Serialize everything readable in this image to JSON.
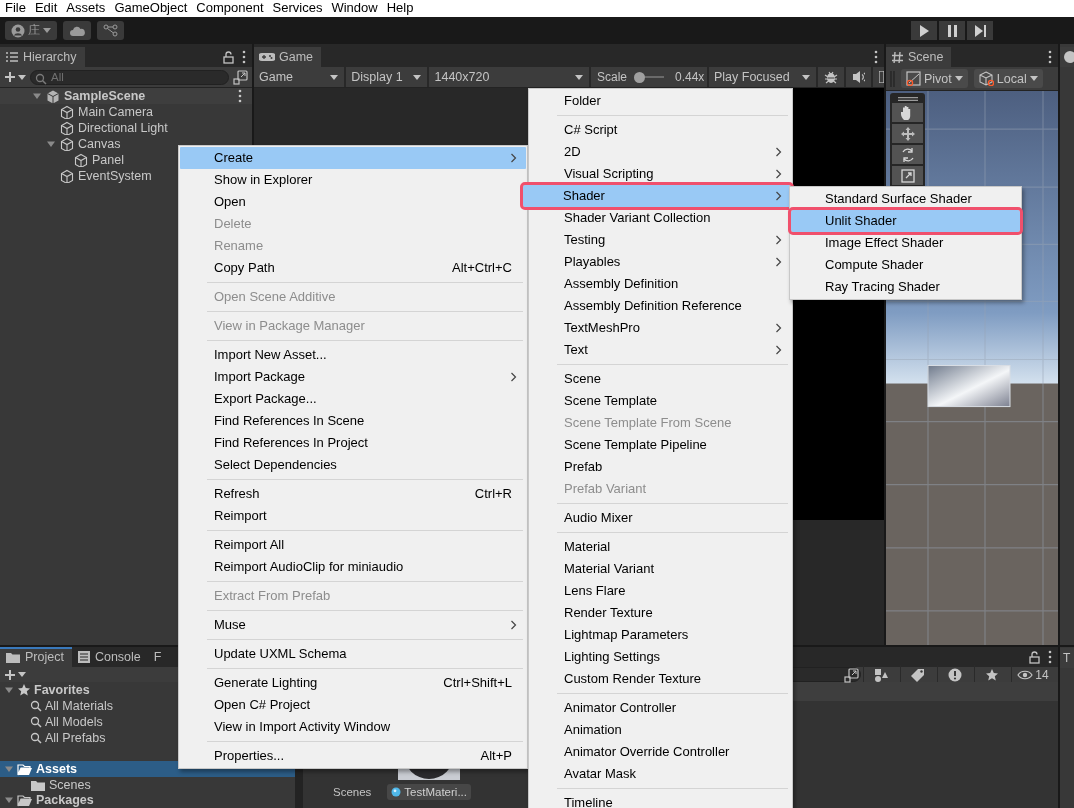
{
  "menu_bar": [
    "File",
    "Edit",
    "Assets",
    "GameObject",
    "Component",
    "Services",
    "Window",
    "Help"
  ],
  "toolbar": {
    "account": "庄"
  },
  "hierarchy": {
    "title": "Hierarchy",
    "search": {
      "placeholder": "All"
    },
    "tree": [
      {
        "label": "SampleScene",
        "kind": "scene",
        "expanded": true,
        "selected": false,
        "children": [
          {
            "label": "Main Camera",
            "kind": "object",
            "selected": false
          },
          {
            "label": "Directional Light",
            "kind": "object",
            "selected": false
          },
          {
            "label": "Canvas",
            "kind": "object",
            "expanded": true,
            "selected": false,
            "children": [
              {
                "label": "Panel",
                "kind": "object",
                "selected": false
              }
            ]
          },
          {
            "label": "EventSystem",
            "kind": "object",
            "selected": false
          }
        ]
      }
    ]
  },
  "game": {
    "title": "Game",
    "view": "Game",
    "display": "Display 1",
    "resolution": "1440x720",
    "scale_label": "Scale",
    "scale": {
      "level": 0.05
    },
    "scale_value": "0.44x",
    "play_mode": "Play Focused"
  },
  "scene": {
    "title": "Scene",
    "pivot": "Pivot",
    "handle": "Local"
  },
  "project": {
    "tabs": [
      {
        "label": "Project",
        "selected": true
      },
      {
        "label": "Console",
        "selected": false
      },
      {
        "label": "F",
        "selected": false
      }
    ],
    "tree": [
      {
        "label": "Favorites",
        "kind": "favorites",
        "expanded": true,
        "selected": false,
        "children": [
          {
            "label": "All Materials",
            "kind": "search",
            "selected": false
          },
          {
            "label": "All Models",
            "kind": "search",
            "selected": false
          },
          {
            "label": "All Prefabs",
            "kind": "search",
            "selected": false
          }
        ]
      },
      {
        "label": "Assets",
        "kind": "folder",
        "expanded": true,
        "selected": true,
        "children": [
          {
            "label": "Scenes",
            "kind": "folder",
            "selected": false
          }
        ]
      },
      {
        "label": "Packages",
        "kind": "folder",
        "expanded": true,
        "selected": false
      }
    ],
    "items": [
      {
        "label": "Scenes",
        "kind": "folder"
      },
      {
        "label": "TestMateri...",
        "kind": "material"
      }
    ],
    "visible_count": "14"
  },
  "inspector": {
    "tab": "T"
  },
  "context_menu": {
    "items": [
      {
        "kind": "item",
        "label": "Create",
        "submenu": true,
        "selected": true,
        "disabled": false
      },
      {
        "kind": "item",
        "label": "Show in Explorer",
        "submenu": false,
        "selected": false,
        "disabled": false
      },
      {
        "kind": "item",
        "label": "Open",
        "submenu": false,
        "selected": false,
        "disabled": false
      },
      {
        "kind": "item",
        "label": "Delete",
        "submenu": false,
        "selected": false,
        "disabled": true
      },
      {
        "kind": "item",
        "label": "Rename",
        "submenu": false,
        "selected": false,
        "disabled": true
      },
      {
        "kind": "item",
        "label": "Copy Path",
        "shortcut": "Alt+Ctrl+C",
        "submenu": false,
        "selected": false,
        "disabled": false
      },
      {
        "kind": "separator"
      },
      {
        "kind": "item",
        "label": "Open Scene Additive",
        "submenu": false,
        "selected": false,
        "disabled": true
      },
      {
        "kind": "separator"
      },
      {
        "kind": "item",
        "label": "View in Package Manager",
        "submenu": false,
        "selected": false,
        "disabled": true
      },
      {
        "kind": "separator"
      },
      {
        "kind": "item",
        "label": "Import New Asset...",
        "submenu": false,
        "selected": false,
        "disabled": false
      },
      {
        "kind": "item",
        "label": "Import Package",
        "submenu": true,
        "selected": false,
        "disabled": false
      },
      {
        "kind": "item",
        "label": "Export Package...",
        "submenu": false,
        "selected": false,
        "disabled": false
      },
      {
        "kind": "item",
        "label": "Find References In Scene",
        "submenu": false,
        "selected": false,
        "disabled": false
      },
      {
        "kind": "item",
        "label": "Find References In Project",
        "submenu": false,
        "selected": false,
        "disabled": false
      },
      {
        "kind": "item",
        "label": "Select Dependencies",
        "submenu": false,
        "selected": false,
        "disabled": false
      },
      {
        "kind": "separator"
      },
      {
        "kind": "item",
        "label": "Refresh",
        "shortcut": "Ctrl+R",
        "submenu": false,
        "selected": false,
        "disabled": false
      },
      {
        "kind": "item",
        "label": "Reimport",
        "submenu": false,
        "selected": false,
        "disabled": false
      },
      {
        "kind": "separator"
      },
      {
        "kind": "item",
        "label": "Reimport All",
        "submenu": false,
        "selected": false,
        "disabled": false
      },
      {
        "kind": "item",
        "label": "Reimport AudioClip for miniaudio",
        "submenu": false,
        "selected": false,
        "disabled": false
      },
      {
        "kind": "separator"
      },
      {
        "kind": "item",
        "label": "Extract From Prefab",
        "submenu": false,
        "selected": false,
        "disabled": true
      },
      {
        "kind": "separator"
      },
      {
        "kind": "item",
        "label": "Muse",
        "submenu": true,
        "selected": false,
        "disabled": false
      },
      {
        "kind": "separator"
      },
      {
        "kind": "item",
        "label": "Update UXML Schema",
        "submenu": false,
        "selected": false,
        "disabled": false
      },
      {
        "kind": "separator"
      },
      {
        "kind": "item",
        "label": "Generate Lighting",
        "shortcut": "Ctrl+Shift+L",
        "submenu": false,
        "selected": false,
        "disabled": false
      },
      {
        "kind": "item",
        "label": "Open C# Project",
        "submenu": false,
        "selected": false,
        "disabled": false
      },
      {
        "kind": "item",
        "label": "View in Import Activity Window",
        "submenu": false,
        "selected": false,
        "disabled": false
      },
      {
        "kind": "separator"
      },
      {
        "kind": "item",
        "label": "Properties...",
        "shortcut": "Alt+P",
        "submenu": false,
        "selected": false,
        "disabled": false
      }
    ]
  },
  "create_menu": {
    "items": [
      {
        "kind": "item",
        "label": "Folder",
        "submenu": false,
        "selected": false,
        "disabled": false
      },
      {
        "kind": "separator"
      },
      {
        "kind": "item",
        "label": "C# Script",
        "submenu": false,
        "selected": false,
        "disabled": false
      },
      {
        "kind": "item",
        "label": "2D",
        "submenu": true,
        "selected": false,
        "disabled": false
      },
      {
        "kind": "item",
        "label": "Visual Scripting",
        "submenu": true,
        "selected": false,
        "disabled": false
      },
      {
        "kind": "item",
        "label": "Shader",
        "submenu": true,
        "selected": true,
        "disabled": false,
        "annotated": true
      },
      {
        "kind": "item",
        "label": "Shader Variant Collection",
        "submenu": false,
        "selected": false,
        "disabled": false
      },
      {
        "kind": "item",
        "label": "Testing",
        "submenu": true,
        "selected": false,
        "disabled": false
      },
      {
        "kind": "item",
        "label": "Playables",
        "submenu": true,
        "selected": false,
        "disabled": false
      },
      {
        "kind": "item",
        "label": "Assembly Definition",
        "submenu": false,
        "selected": false,
        "disabled": false
      },
      {
        "kind": "item",
        "label": "Assembly Definition Reference",
        "submenu": false,
        "selected": false,
        "disabled": false
      },
      {
        "kind": "item",
        "label": "TextMeshPro",
        "submenu": true,
        "selected": false,
        "disabled": false
      },
      {
        "kind": "item",
        "label": "Text",
        "submenu": true,
        "selected": false,
        "disabled": false
      },
      {
        "kind": "separator"
      },
      {
        "kind": "item",
        "label": "Scene",
        "submenu": false,
        "selected": false,
        "disabled": false
      },
      {
        "kind": "item",
        "label": "Scene Template",
        "submenu": false,
        "selected": false,
        "disabled": false
      },
      {
        "kind": "item",
        "label": "Scene Template From Scene",
        "submenu": false,
        "selected": false,
        "disabled": true
      },
      {
        "kind": "item",
        "label": "Scene Template Pipeline",
        "submenu": false,
        "selected": false,
        "disabled": false
      },
      {
        "kind": "item",
        "label": "Prefab",
        "submenu": false,
        "selected": false,
        "disabled": false
      },
      {
        "kind": "item",
        "label": "Prefab Variant",
        "submenu": false,
        "selected": false,
        "disabled": true
      },
      {
        "kind": "separator"
      },
      {
        "kind": "item",
        "label": "Audio Mixer",
        "submenu": false,
        "selected": false,
        "disabled": false
      },
      {
        "kind": "separator"
      },
      {
        "kind": "item",
        "label": "Material",
        "submenu": false,
        "selected": false,
        "disabled": false
      },
      {
        "kind": "item",
        "label": "Material Variant",
        "submenu": false,
        "selected": false,
        "disabled": false
      },
      {
        "kind": "item",
        "label": "Lens Flare",
        "submenu": false,
        "selected": false,
        "disabled": false
      },
      {
        "kind": "item",
        "label": "Render Texture",
        "submenu": false,
        "selected": false,
        "disabled": false
      },
      {
        "kind": "item",
        "label": "Lightmap Parameters",
        "submenu": false,
        "selected": false,
        "disabled": false
      },
      {
        "kind": "item",
        "label": "Lighting Settings",
        "submenu": false,
        "selected": false,
        "disabled": false
      },
      {
        "kind": "item",
        "label": "Custom Render Texture",
        "submenu": false,
        "selected": false,
        "disabled": false
      },
      {
        "kind": "separator"
      },
      {
        "kind": "item",
        "label": "Animator Controller",
        "submenu": false,
        "selected": false,
        "disabled": false
      },
      {
        "kind": "item",
        "label": "Animation",
        "submenu": false,
        "selected": false,
        "disabled": false
      },
      {
        "kind": "item",
        "label": "Animator Override Controller",
        "submenu": false,
        "selected": false,
        "disabled": false
      },
      {
        "kind": "item",
        "label": "Avatar Mask",
        "submenu": false,
        "selected": false,
        "disabled": false
      },
      {
        "kind": "separator"
      },
      {
        "kind": "item",
        "label": "Timeline",
        "submenu": false,
        "selected": false,
        "disabled": false
      }
    ]
  },
  "shader_menu": {
    "items": [
      {
        "kind": "item",
        "label": "Standard Surface Shader",
        "submenu": false,
        "selected": false,
        "disabled": false
      },
      {
        "kind": "item",
        "label": "Unlit Shader",
        "submenu": false,
        "selected": true,
        "disabled": false,
        "annotated": true
      },
      {
        "kind": "item",
        "label": "Image Effect Shader",
        "submenu": false,
        "selected": false,
        "disabled": false
      },
      {
        "kind": "item",
        "label": "Compute Shader",
        "submenu": false,
        "selected": false,
        "disabled": false
      },
      {
        "kind": "item",
        "label": "Ray Tracing Shader",
        "submenu": false,
        "selected": false,
        "disabled": false
      }
    ]
  }
}
